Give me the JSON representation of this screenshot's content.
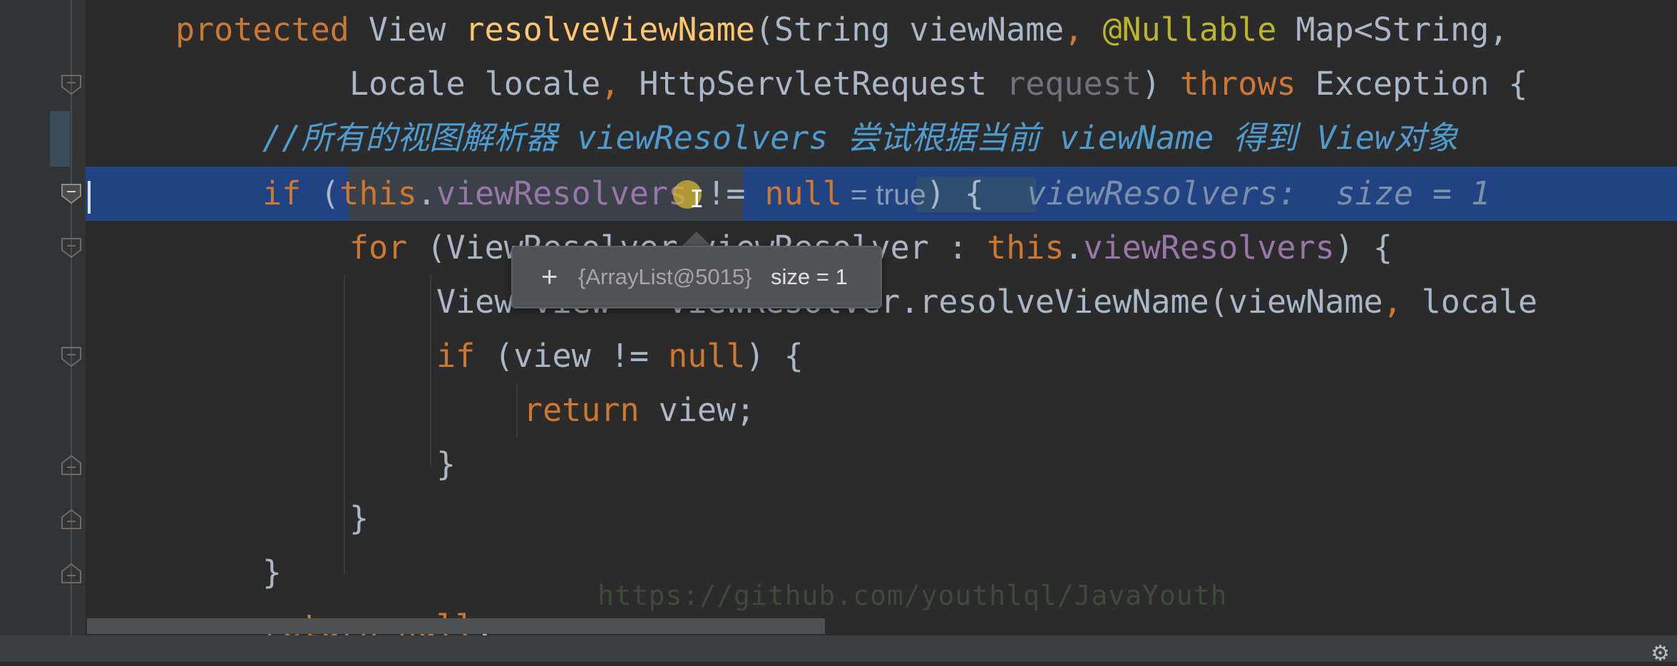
{
  "code": {
    "line1": {
      "kw": "protected",
      "type": " View ",
      "fn": "resolveViewName",
      "a": "(String viewName",
      "comma": ",",
      "sp": " ",
      "ann": "@Nullable",
      "rest": " Map<String,"
    },
    "line2": {
      "a": "Locale locale",
      "comma": ",",
      "b": " HttpServletRequest ",
      "param": "request",
      "c": ") ",
      "kw": "throws",
      "d": " Exception {"
    },
    "line3": {
      "comment": "//所有的视图解析器 viewResolvers 尝试根据当前 viewName 得到 View对象"
    },
    "line4": {
      "kw": "if",
      "a": " (",
      "this": "this",
      "dot": ".",
      "fld": "viewResolvers",
      "b": " != ",
      "kw2": "null",
      "inline_true": "= true",
      "c": ") {",
      "hint": "viewResolvers:  size = 1"
    },
    "line5": {
      "kw": "for",
      "a": " (ViewResolver viewResolver : ",
      "this": "this",
      "dot": ".",
      "fld": "viewResolvers",
      "b": ") {"
    },
    "line6": {
      "a": "View view = viewResolver.resolveViewName(viewName",
      "comma": ",",
      "b": " locale"
    },
    "line7": {
      "kw": "if",
      "a": " (view != ",
      "kw2": "null",
      "b": ") {"
    },
    "line8": {
      "kw": "return",
      "a": " view;"
    },
    "line9": {
      "a": "}"
    },
    "line10": {
      "a": "}"
    },
    "line11": {
      "a": "}"
    },
    "line12": {
      "kw": "return",
      "a": " ",
      "kw2": "null",
      "b": ";"
    }
  },
  "tooltip": {
    "plus": "+",
    "object": "{ArrayList@5015}",
    "size": "size = 1"
  },
  "watermark": "https://github.com/youthlql/JavaYouth",
  "colors": {
    "background": "#2b2b2b",
    "keyword": "#cc7832",
    "method": "#ffc66d",
    "annotation": "#bbb529",
    "field": "#9876aa",
    "comment": "#4e9bcf",
    "selection": "#214283"
  }
}
